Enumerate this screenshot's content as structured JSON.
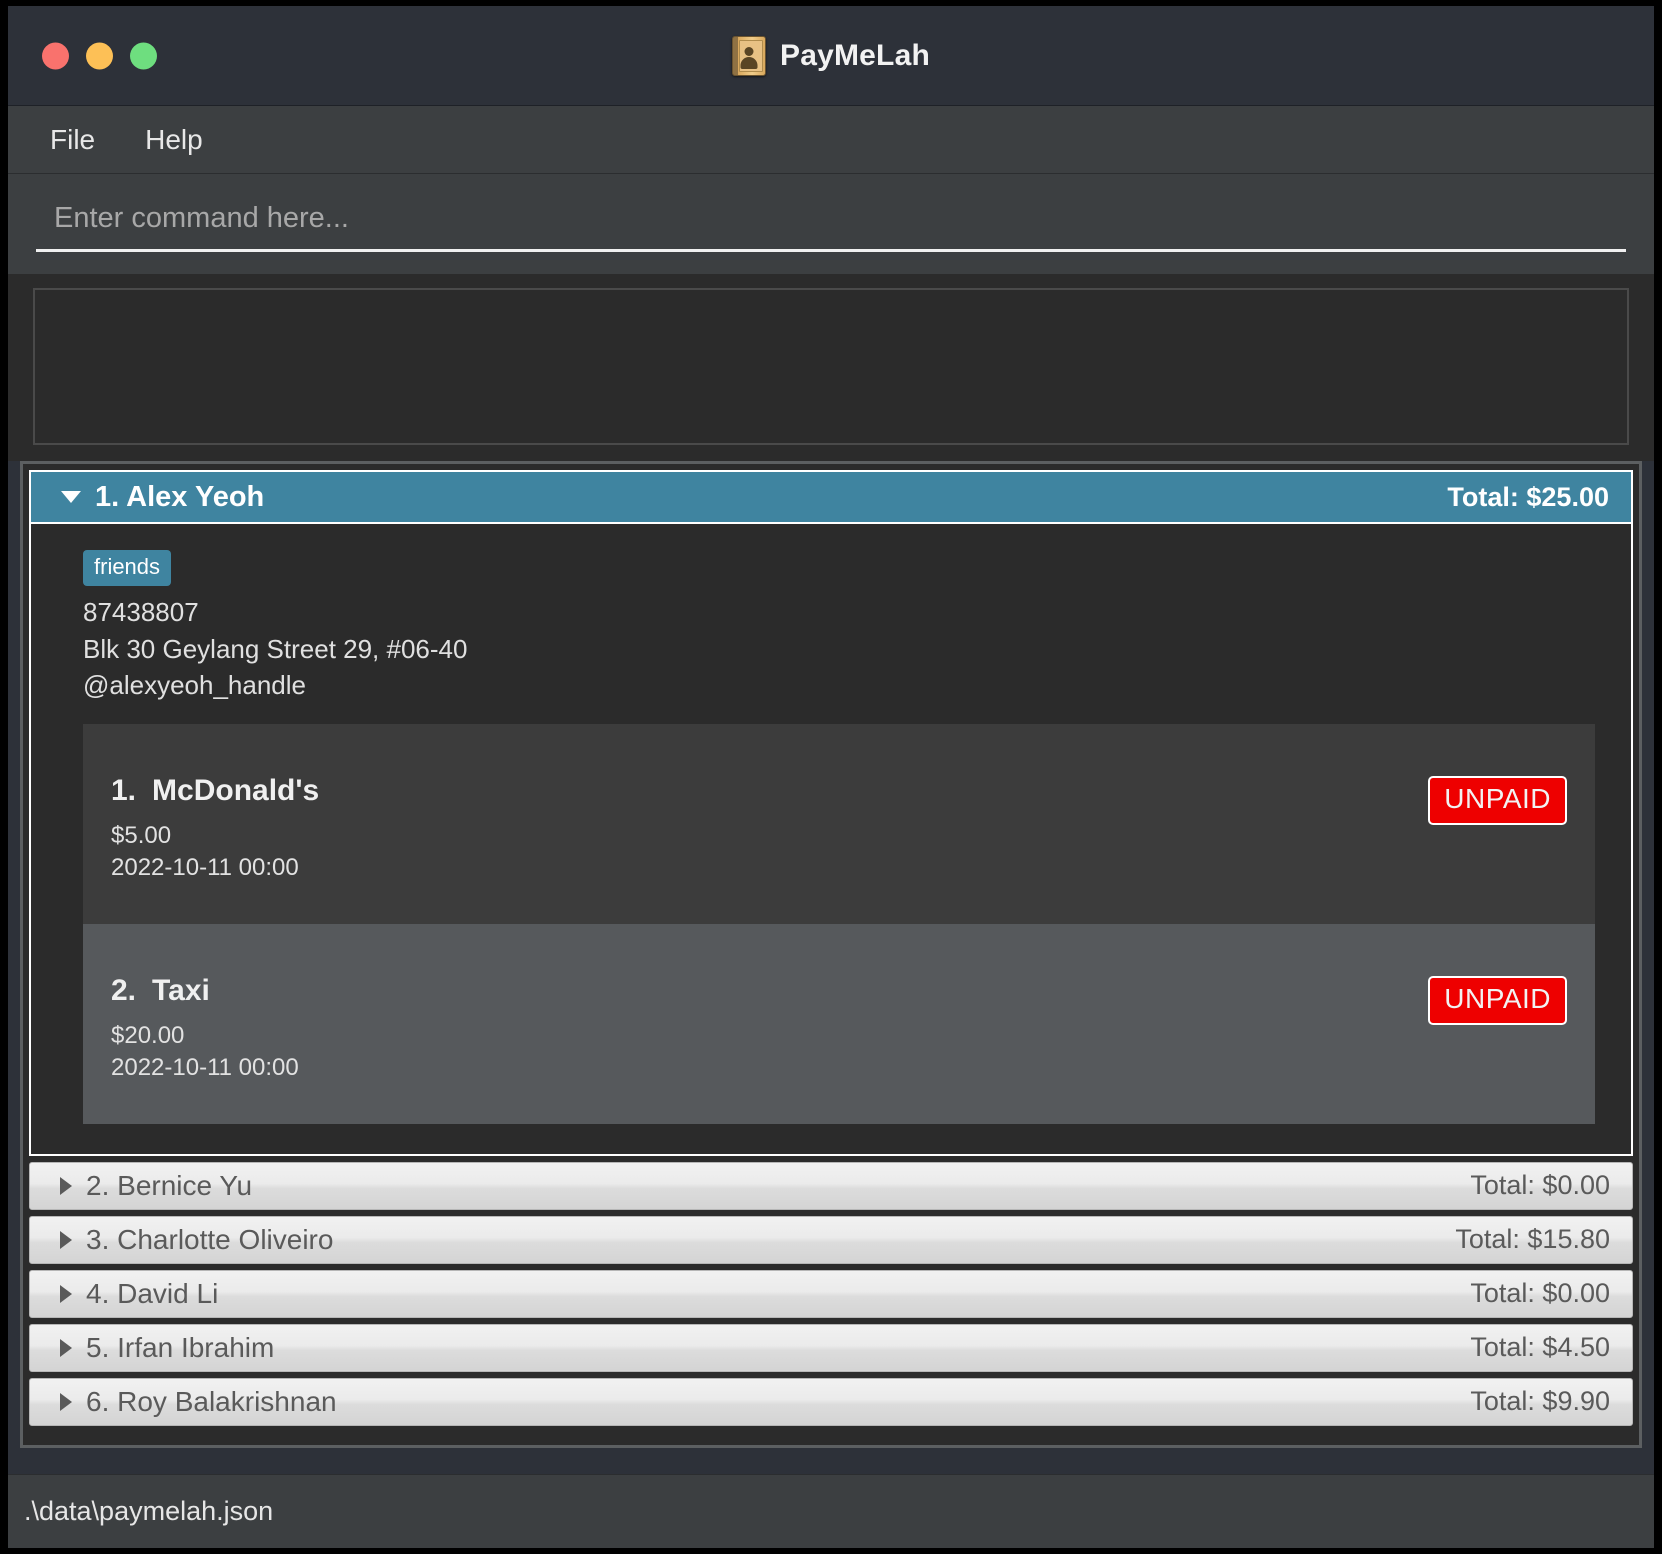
{
  "window": {
    "title": "PayMeLah",
    "icon": "address-book-icon",
    "traffic_lights": {
      "close": "close-button",
      "minimize": "minimize-button",
      "maximize": "maximize-button"
    },
    "accent_color": "#3f84a0",
    "unpaid_color": "#ee0000"
  },
  "menubar": {
    "items": [
      {
        "label": "File"
      },
      {
        "label": "Help"
      }
    ]
  },
  "command": {
    "placeholder": "Enter command here...",
    "value": ""
  },
  "result": {
    "text": ""
  },
  "persons": [
    {
      "index": "1.",
      "name": "Alex Yeoh",
      "total_label": "Total: $25.00",
      "expanded": true,
      "tags": [
        "friends"
      ],
      "phone": "87438807",
      "address": "Blk 30 Geylang Street 29, #06-40",
      "handle": "@alexyeoh_handle",
      "bills": [
        {
          "index": "1.",
          "title": "McDonald's",
          "amount": "$5.00",
          "date": "2022-10-11 00:00",
          "status": "UNPAID"
        },
        {
          "index": "2.",
          "title": "Taxi",
          "amount": "$20.00",
          "date": "2022-10-11 00:00",
          "status": "UNPAID"
        }
      ]
    },
    {
      "index": "2.",
      "name": "Bernice Yu",
      "total_label": "Total: $0.00",
      "expanded": false
    },
    {
      "index": "3.",
      "name": "Charlotte Oliveiro",
      "total_label": "Total: $15.80",
      "expanded": false
    },
    {
      "index": "4.",
      "name": "David Li",
      "total_label": "Total: $0.00",
      "expanded": false
    },
    {
      "index": "5.",
      "name": "Irfan Ibrahim",
      "total_label": "Total: $4.50",
      "expanded": false
    },
    {
      "index": "6.",
      "name": "Roy Balakrishnan",
      "total_label": "Total: $9.90",
      "expanded": false
    }
  ],
  "statusbar": {
    "path": ".\\data\\paymelah.json"
  }
}
